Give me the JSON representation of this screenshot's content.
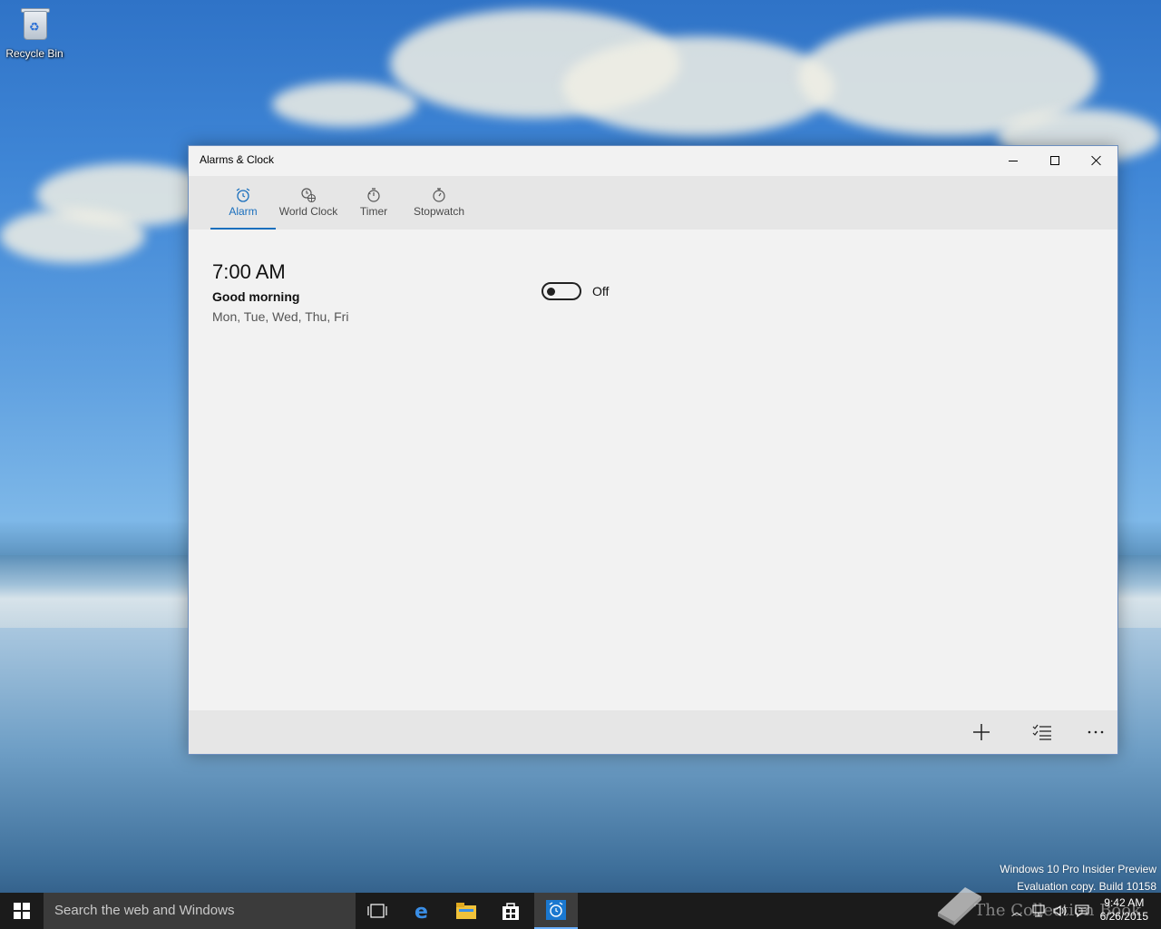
{
  "desktop": {
    "icons": [
      {
        "label": "Recycle Bin",
        "icon": "recycle-bin-icon"
      }
    ],
    "watermark": {
      "line1": "Windows 10 Pro Insider Preview",
      "line2": "Evaluation copy. Build 10158"
    }
  },
  "window": {
    "title": "Alarms & Clock",
    "controls": {
      "minimize": "minimize-icon",
      "maximize": "maximize-icon",
      "close": "close-icon"
    },
    "tabs": [
      {
        "label": "Alarm",
        "icon": "alarm-clock-icon",
        "active": true
      },
      {
        "label": "World Clock",
        "icon": "world-clock-icon",
        "active": false
      },
      {
        "label": "Timer",
        "icon": "timer-icon",
        "active": false
      },
      {
        "label": "Stopwatch",
        "icon": "stopwatch-icon",
        "active": false
      }
    ],
    "alarms": [
      {
        "time": "7:00 AM",
        "name": "Good morning",
        "days": "Mon, Tue, Wed, Thu, Fri",
        "toggle_state": "Off"
      }
    ],
    "commands": [
      {
        "icon": "add-icon"
      },
      {
        "icon": "select-list-icon"
      },
      {
        "icon": "more-icon"
      }
    ],
    "accent": "#1a6fbd"
  },
  "taskbar": {
    "search_placeholder": "Search the web and Windows",
    "pinned": [
      "task-view-icon",
      "edge-icon",
      "file-explorer-icon",
      "store-icon",
      "alarms-app-icon"
    ],
    "clock": {
      "time": "9:42 AM",
      "date": "6/26/2015"
    },
    "brand": "The Collection Book"
  }
}
